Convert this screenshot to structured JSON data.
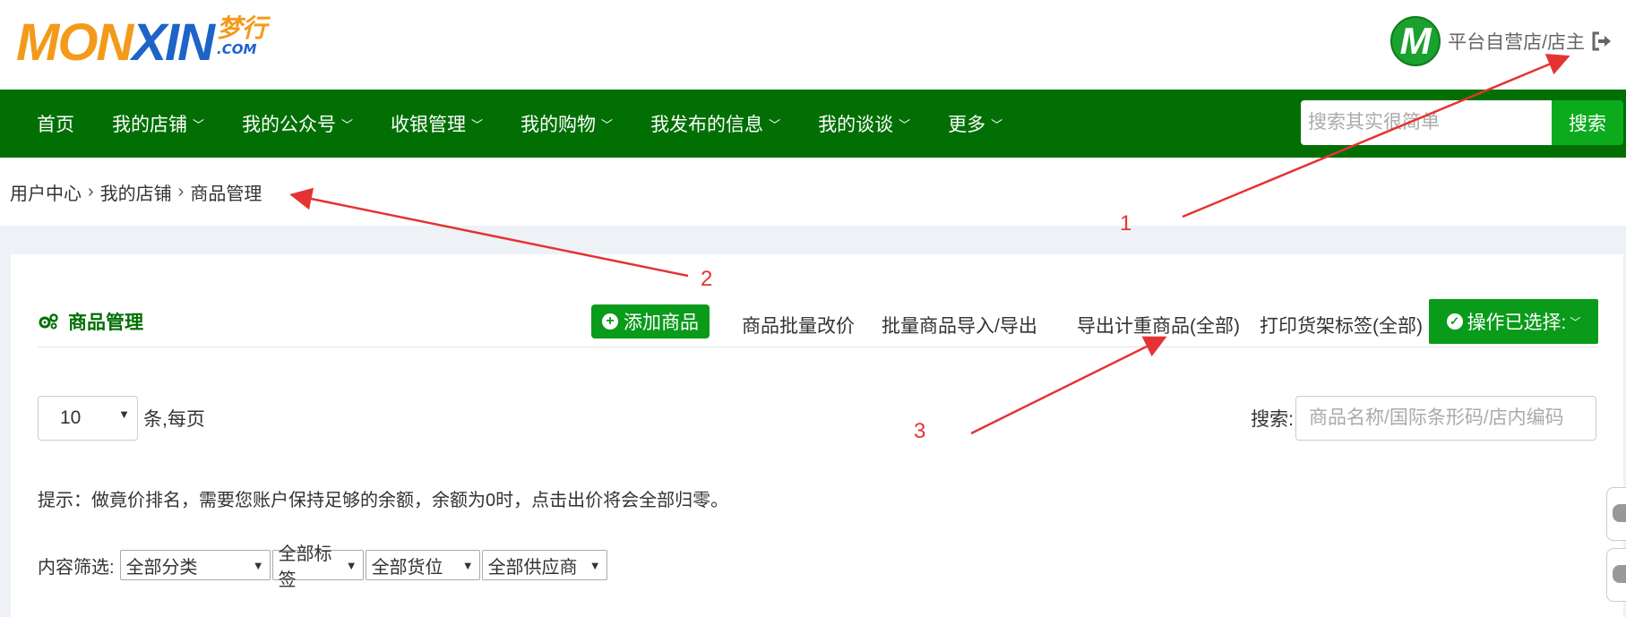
{
  "header": {
    "logo_main_a": "MON",
    "logo_main_b": "XIN",
    "logo_cn": "梦行",
    "logo_com": ".COM",
    "avatar_letter": "M",
    "user_name": "平台自营店/店主"
  },
  "nav": {
    "items": [
      {
        "label": "首页",
        "has_menu": false
      },
      {
        "label": "我的店铺",
        "has_menu": true
      },
      {
        "label": "我的公众号",
        "has_menu": true
      },
      {
        "label": "收银管理",
        "has_menu": true
      },
      {
        "label": "我的购物",
        "has_menu": true
      },
      {
        "label": "我发布的信息",
        "has_menu": true
      },
      {
        "label": "我的谈谈",
        "has_menu": true
      },
      {
        "label": "更多",
        "has_menu": true
      }
    ],
    "search_placeholder": "搜索其实很简单",
    "search_button": "搜索"
  },
  "breadcrumb": {
    "items": [
      "用户中心",
      "我的店铺",
      "商品管理"
    ],
    "separator": "›"
  },
  "panel": {
    "title": "商品管理",
    "add_button": "添加商品",
    "links": [
      "商品批量改价",
      "批量商品导入/导出",
      "导出计重商品(全部)",
      "打印货架标签(全部)"
    ],
    "operation_button": "操作已选择:",
    "page_size": "10",
    "page_size_label": "条,每页",
    "search_label": "搜索:",
    "search_placeholder": "商品名称/国际条形码/店内编码",
    "hint": "提示：做竟价排名，需要您账户保持足够的余额，余额为0时，点击出价将会全部归零。",
    "filter_label": "内容筛选:",
    "filters": [
      "全部分类",
      "全部标签",
      "全部货位",
      "全部供应商"
    ]
  },
  "annotations": [
    "1",
    "2",
    "3"
  ],
  "colors": {
    "nav_bg": "#016f04",
    "primary_button": "#0a9b1a",
    "logo_orange": "#f39a1b",
    "logo_blue": "#1d63c8",
    "annotation_red": "#e53333"
  }
}
